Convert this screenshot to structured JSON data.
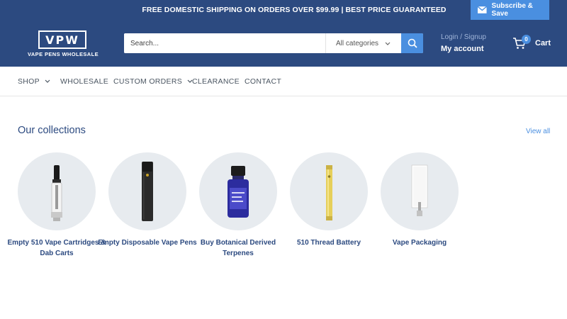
{
  "announcement": {
    "text": "FREE DOMESTIC SHIPPING ON ORDERS OVER $99.99 | BEST PRICE GUARANTEED",
    "subscribe_label": "Subscribe & Save",
    "subscribe_icon": "envelope-icon"
  },
  "header": {
    "logo_mark": "VPW",
    "logo_text": "VAPE PENS WHOLESALE",
    "search": {
      "placeholder": "Search...",
      "category_value": "All categories",
      "button_icon": "search-icon"
    },
    "account": {
      "login_label": "Login / Signup",
      "my_account_label": "My account"
    },
    "cart": {
      "count": "0",
      "label": "Cart",
      "icon": "cart-icon"
    }
  },
  "nav": {
    "items": [
      {
        "label": "SHOP",
        "has_dropdown": true
      },
      {
        "label": "WHOLESALE",
        "has_dropdown": false
      },
      {
        "label": "CUSTOM ORDERS",
        "has_dropdown": true
      },
      {
        "label": "CLEARANCE",
        "has_dropdown": false
      },
      {
        "label": "CONTACT",
        "has_dropdown": false
      }
    ]
  },
  "collections": {
    "title": "Our collections",
    "view_all_label": "View all",
    "items": [
      {
        "label": "Empty 510 Vape Cartridges & Dab Carts",
        "image": "cartridge"
      },
      {
        "label": "Empty Disposable Vape Pens",
        "image": "disposable-pen"
      },
      {
        "label": "Buy Botanical Derived Terpenes",
        "image": "terpene-bottle"
      },
      {
        "label": "510 Thread Battery",
        "image": "battery"
      },
      {
        "label": "Vape Packaging",
        "image": "packaging"
      }
    ]
  },
  "colors": {
    "brand_navy": "#2c4a80",
    "accent_blue": "#4a8fe0",
    "circle_bg": "#e7ebef"
  }
}
